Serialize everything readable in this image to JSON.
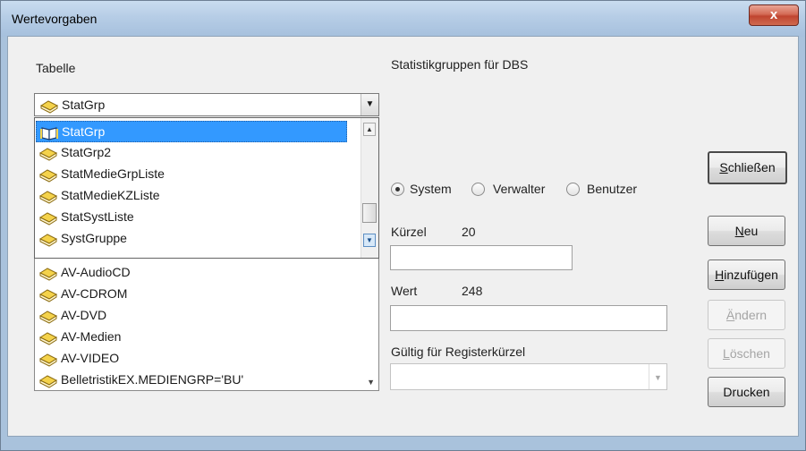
{
  "window": {
    "title": "Wertevorgaben",
    "close_symbol": "x"
  },
  "left": {
    "label": "Tabelle",
    "combo_value": "StatGrp",
    "dropdown_items": [
      {
        "label": "StatGrp",
        "icon": "open-book-icon",
        "selected": true
      },
      {
        "label": "StatGrp2",
        "icon": "book-icon"
      },
      {
        "label": "StatMedieGrpListe",
        "icon": "book-icon"
      },
      {
        "label": "StatMedieKZListe",
        "icon": "book-icon"
      },
      {
        "label": "StatSystListe",
        "icon": "book-icon"
      },
      {
        "label": "SystGruppe",
        "icon": "book-icon"
      }
    ],
    "list_items": [
      {
        "label": "AV-AudioCD"
      },
      {
        "label": "AV-CDROM"
      },
      {
        "label": "AV-DVD"
      },
      {
        "label": "AV-Medien"
      },
      {
        "label": "AV-VIDEO"
      },
      {
        "label": "BelletristikEX.MEDIENGRP='BU'"
      }
    ]
  },
  "right": {
    "heading": "Statistikgruppen für DBS",
    "radios": [
      {
        "label": "System",
        "checked": true
      },
      {
        "label": "Verwalter",
        "checked": false
      },
      {
        "label": "Benutzer",
        "checked": false
      }
    ],
    "kuerzel": {
      "label": "Kürzel",
      "length": "20",
      "value": ""
    },
    "wert": {
      "label": "Wert",
      "length": "248",
      "value": ""
    },
    "gueltig": {
      "label": "Gültig für Registerkürzel",
      "value": ""
    }
  },
  "buttons": {
    "schliessen": {
      "mnemonic": "S",
      "rest": "chließen"
    },
    "neu": {
      "mnemonic": "N",
      "rest": "eu"
    },
    "hinzufuegen": {
      "mnemonic": "H",
      "rest": "inzufügen"
    },
    "aendern": {
      "mnemonic": "Ä",
      "rest": "ndern"
    },
    "loeschen": {
      "mnemonic": "L",
      "rest": "öschen"
    },
    "drucken": {
      "label": "Drucken"
    }
  },
  "colors": {
    "selection": "#3399ff",
    "title_bar": "#b6cde6",
    "close_button": "#c04530"
  }
}
